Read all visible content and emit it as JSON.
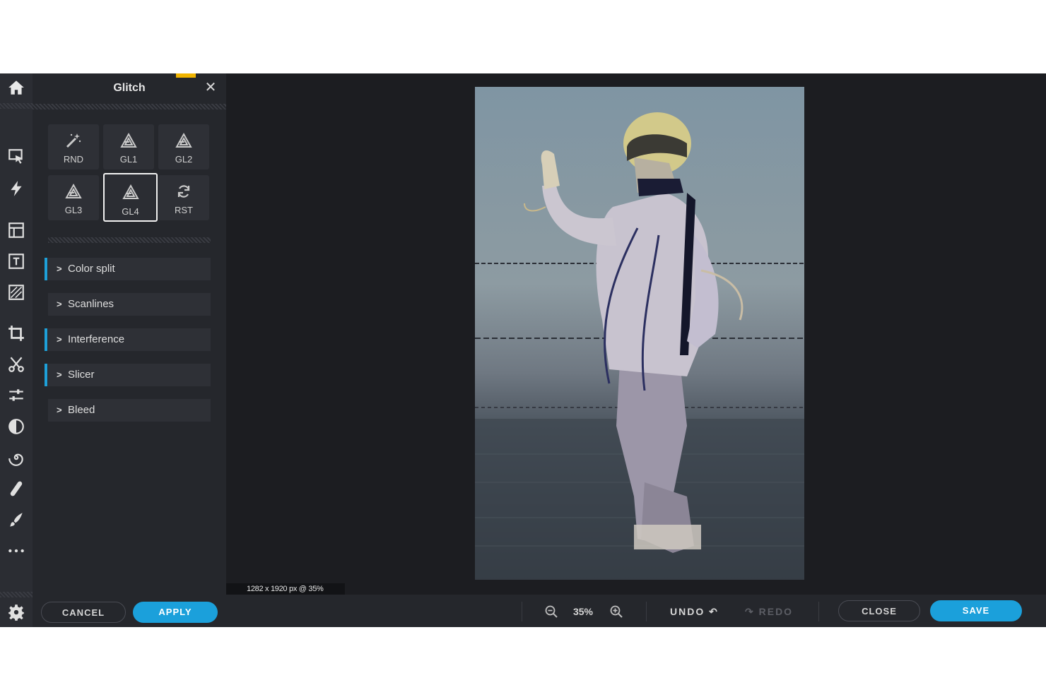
{
  "panel": {
    "title": "Glitch",
    "presets": [
      {
        "label": "RND",
        "icon": "magic-wand-icon"
      },
      {
        "label": "GL1",
        "icon": "glitch-triangle-icon"
      },
      {
        "label": "GL2",
        "icon": "glitch-triangle-icon"
      },
      {
        "label": "GL3",
        "icon": "glitch-triangle-icon"
      },
      {
        "label": "GL4",
        "icon": "glitch-triangle-icon",
        "selected": true
      },
      {
        "label": "RST",
        "icon": "reset-icon"
      }
    ],
    "sections": [
      {
        "label": "Color split",
        "active": true
      },
      {
        "label": "Scanlines",
        "active": false
      },
      {
        "label": "Interference",
        "active": true
      },
      {
        "label": "Slicer",
        "active": true
      },
      {
        "label": "Bleed",
        "active": false
      }
    ],
    "cancel_label": "CANCEL",
    "apply_label": "APPLY"
  },
  "toolbar": {
    "icons": [
      "home-icon",
      "select-icon",
      "lightning-icon",
      "layers-icon",
      "text-icon",
      "texture-icon",
      "crop-icon",
      "cut-icon",
      "adjust-icon",
      "contrast-icon",
      "spiral-icon",
      "bandage-icon",
      "brush-icon",
      "more-icon",
      "settings-icon"
    ]
  },
  "canvas": {
    "status": "1282 x 1920 px @ 35%"
  },
  "bottombar": {
    "zoom": "35%",
    "undo_label": "UNDO",
    "redo_label": "REDO",
    "close_label": "CLOSE",
    "save_label": "SAVE"
  },
  "colors": {
    "accent_blue": "#1ba0db",
    "accent_yellow": "#f0b400",
    "panel_bg": "#25272c",
    "canvas_bg": "#1c1d21"
  }
}
